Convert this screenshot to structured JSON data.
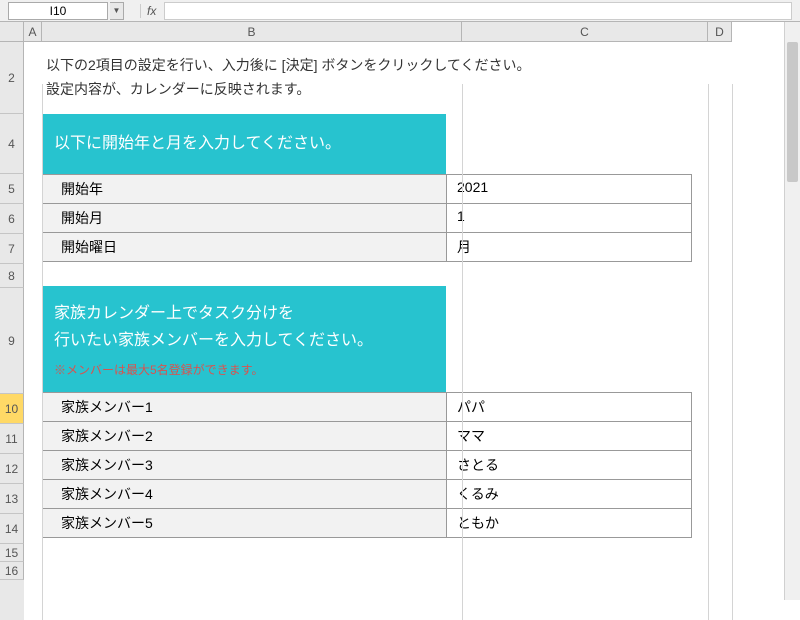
{
  "formula_bar": {
    "cell_ref": "I10",
    "fx": "fx",
    "formula_value": ""
  },
  "columns": [
    "A",
    "B",
    "C",
    "D"
  ],
  "rows": [
    "2",
    "4",
    "5",
    "6",
    "7",
    "8",
    "9",
    "10",
    "11",
    "12",
    "13",
    "14",
    "15",
    "16"
  ],
  "selected_row": "10",
  "instructions": {
    "line1": "以下の2項目の設定を行い、入力後に [決定] ボタンをクリックしてください。",
    "line2": "設定内容が、カレンダーに反映されます。"
  },
  "section1": {
    "title": "以下に開始年と月を入力してください。",
    "rows": [
      {
        "label": "開始年",
        "value": "2021"
      },
      {
        "label": "開始月",
        "value": "1"
      },
      {
        "label": "開始曜日",
        "value": "月"
      }
    ]
  },
  "section2": {
    "title_l1": "家族カレンダー上でタスク分けを",
    "title_l2": "行いたい家族メンバーを入力してください。",
    "note": "※メンバーは最大5名登録ができます。",
    "rows": [
      {
        "label": "家族メンバー1",
        "value": "パパ"
      },
      {
        "label": "家族メンバー2",
        "value": "ママ"
      },
      {
        "label": "家族メンバー3",
        "value": "さとる"
      },
      {
        "label": "家族メンバー4",
        "value": "くるみ"
      },
      {
        "label": "家族メンバー5",
        "value": "ともか"
      }
    ]
  }
}
